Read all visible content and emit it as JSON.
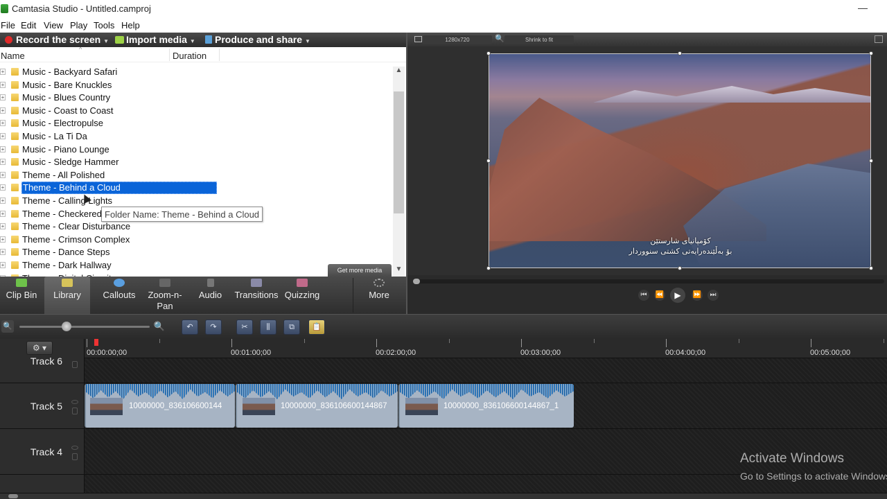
{
  "window": {
    "title": "Camtasia Studio - Untitled.camproj",
    "minimize_glyph": "—"
  },
  "menu": [
    "File",
    "Edit",
    "View",
    "Play",
    "Tools",
    "Help"
  ],
  "toolbar": {
    "record": "Record the screen",
    "import": "Import media",
    "produce": "Produce and share",
    "caret": "▼"
  },
  "library": {
    "columns": {
      "name": "Name",
      "duration": "Duration"
    },
    "items": [
      "Music - Backyard Safari",
      "Music - Bare Knuckles",
      "Music - Blues Country",
      "Music - Coast to Coast",
      "Music - Electropulse",
      "Music - La Ti Da",
      "Music - Piano Lounge",
      "Music - Sledge Hammer",
      "Theme - All Polished",
      "Theme - Behind a Cloud",
      "Theme - Calling Lights",
      "Theme - Checkered",
      "Theme - Clear Disturbance",
      "Theme - Crimson Complex",
      "Theme - Dance Steps",
      "Theme - Dark Hallway",
      "Theme - Digital Circuit"
    ],
    "selected_index": 9,
    "tooltip": "Folder Name: Theme - Behind a Cloud",
    "get_more": "Get more media"
  },
  "preview": {
    "dimensions": "1280x720",
    "zoom": "Shrink to fit",
    "subtitle_line1": "کۆمپانیای شارستێن",
    "subtitle_line2": "بۆ بەڵێندەرایەتی کشتی سنووردار"
  },
  "tabs": [
    {
      "label": "Clip Bin",
      "icon": "clip-bin-icon"
    },
    {
      "label": "Library",
      "icon": "library-icon"
    },
    {
      "label": "Callouts",
      "icon": "callouts-icon"
    },
    {
      "label": "Zoom-n-\nPan",
      "icon": "zoom-n-pan-icon"
    },
    {
      "label": "Audio",
      "icon": "audio-icon"
    },
    {
      "label": "Transitions",
      "icon": "transitions-icon"
    },
    {
      "label": "Quizzing",
      "icon": "quizzing-icon"
    },
    {
      "label": "More",
      "icon": "more-icon"
    }
  ],
  "active_tab": "Library",
  "timeline": {
    "ruler_labels": [
      "00:00:00;00",
      "00:01:00;00",
      "00:02:00;00",
      "00:03:00;00",
      "00:04:00;00",
      "00:05:00;00"
    ],
    "tracks": [
      "Track 6",
      "Track 5",
      "Track 4"
    ],
    "clips": [
      {
        "label": "10000000_836106600144"
      },
      {
        "label": "10000000_836106600144867"
      },
      {
        "label": "10000000_836106600144867_1"
      }
    ]
  },
  "watermark": {
    "line1": "Activate Windows",
    "line2": "Go to Settings to activate Windows."
  }
}
